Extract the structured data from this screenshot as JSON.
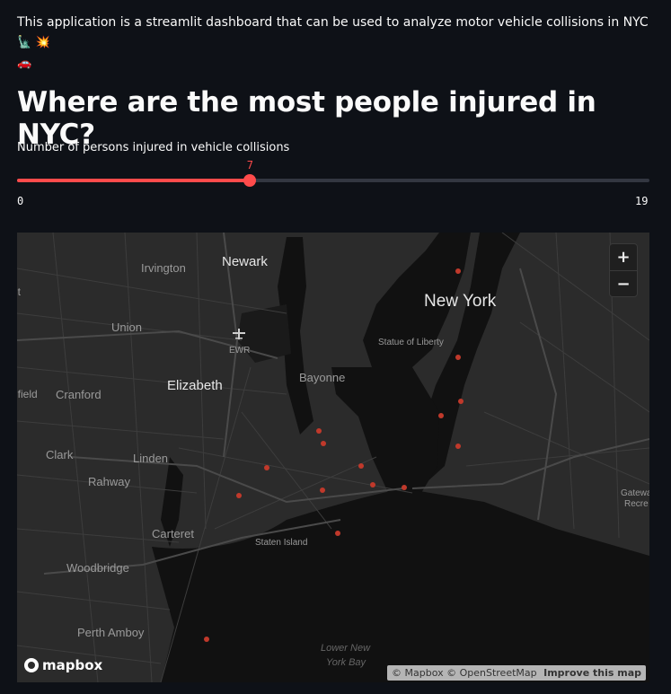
{
  "intro": {
    "text": "This application is a streamlit dashboard that can be used to analyze motor vehicle collisions in NYC",
    "emoji1": "🗽",
    "emoji2": "💥",
    "emoji3": "🚗"
  },
  "heading": "Where are the most people injured in NYC?",
  "slider": {
    "label": "Number of persons injured in vehicle collisions",
    "value": 7,
    "value_text": "7",
    "min": 0,
    "min_text": "0",
    "max": 19,
    "max_text": "19",
    "accent": "#ff4b4b"
  },
  "map": {
    "places": [
      "Irvington",
      "Newark",
      "New York",
      "Statue of Liberty",
      "Union",
      "EWR",
      "Bayonne",
      "Elizabeth",
      "Cranford",
      "Clark",
      "Linden",
      "Rahway",
      "Carteret",
      "Staten Island",
      "Woodbridge",
      "Perth Amboy",
      "Lower New",
      "York Bay",
      "Gatewa",
      "Recre",
      "ifield",
      "it"
    ],
    "zoom_in": "+",
    "zoom_out": "−",
    "logo": "mapbox",
    "attribution": "© Mapbox © OpenStreetMap",
    "improve": "Improve this map",
    "point_color": "#c0392b"
  }
}
